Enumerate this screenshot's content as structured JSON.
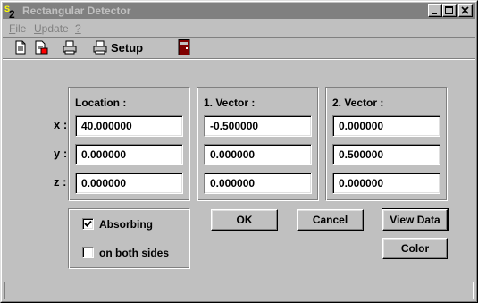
{
  "window": {
    "title": "Rectangular Detector"
  },
  "menu": [
    {
      "label": "File",
      "underline": "F",
      "rest": "ile"
    },
    {
      "label": "Update",
      "underline": "U",
      "rest": "pdate"
    },
    {
      "label": "?",
      "underline": "?",
      "rest": ""
    }
  ],
  "toolbar": {
    "icons": [
      "new-document-icon",
      "save-document-icon",
      "print-icon",
      "print-setup-icon",
      "exit-door-icon"
    ],
    "setup_label": "Setup"
  },
  "location": {
    "title": "Location :",
    "x": "40.000000",
    "y": "0.000000",
    "z": "0.000000"
  },
  "vector1": {
    "title": "1. Vector :",
    "x": "-0.500000",
    "y": "0.000000",
    "z": "0.000000"
  },
  "vector2": {
    "title": "2. Vector :",
    "x": "0.000000",
    "y": "0.500000",
    "z": "0.000000"
  },
  "axes": {
    "x": "x :",
    "y": "y :",
    "z": "z :"
  },
  "options": {
    "absorbing_label": "Absorbing",
    "absorbing_checked": true,
    "both_sides_label": "on both sides",
    "both_sides_checked": false
  },
  "buttons": {
    "ok": "OK",
    "cancel": "Cancel",
    "view_data": "View Data",
    "color": "Color"
  },
  "colors": {
    "face": "#c0c0c0",
    "title_inactive": "#808080",
    "door_red": "#800000"
  }
}
